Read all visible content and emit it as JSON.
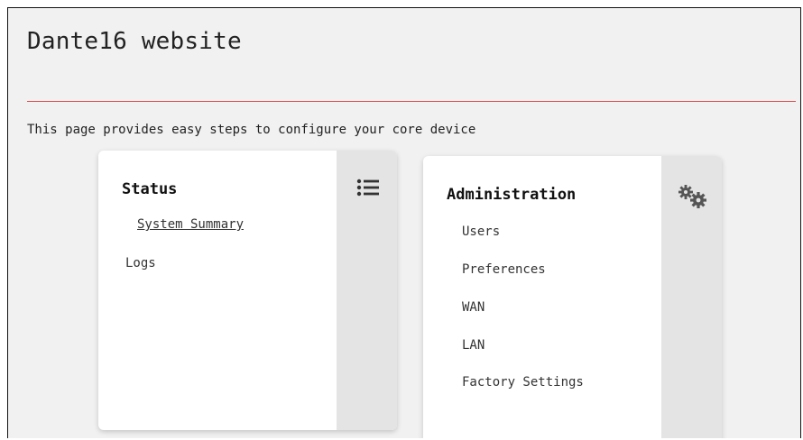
{
  "page": {
    "title": "Dante16 website",
    "intro": "This page provides easy steps to configure your core device"
  },
  "status_card": {
    "title": "Status",
    "icon": "list-icon",
    "links": [
      "System Summary",
      "Logs"
    ]
  },
  "admin_card": {
    "title": "Administration",
    "icon": "gears-icon",
    "links": [
      "Users",
      "Preferences",
      "WAN",
      "LAN",
      "Factory Settings"
    ]
  },
  "colors": {
    "divider": "#e05252",
    "page_bg": "#f1f1f1",
    "card_side": "#e4e4e4"
  }
}
